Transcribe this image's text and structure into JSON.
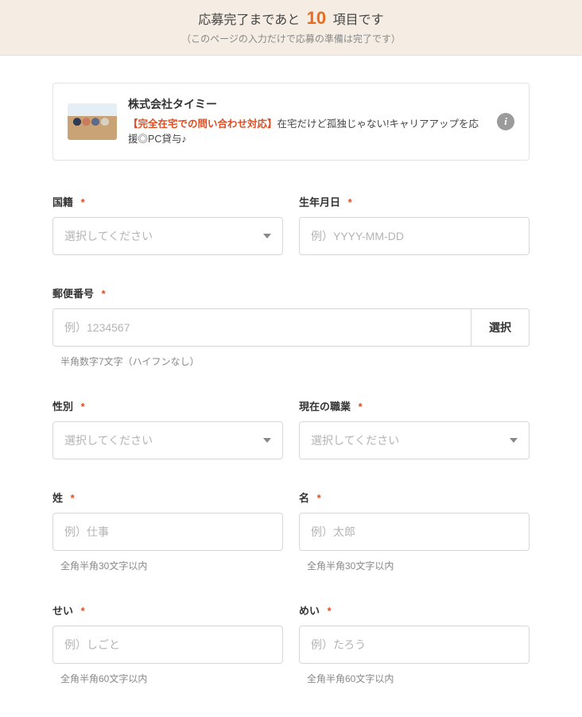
{
  "progress": {
    "prefix": "応募完了まであと",
    "count": "10",
    "suffix": "項目です",
    "sub": "（このページの入力だけで応募の準備は完了です）"
  },
  "job": {
    "company": "株式会社タイミー",
    "title_prefix": "【完全在宅での問い合わせ対応】",
    "title_rest": "在宅だけど孤独じゃない!キャリアアップを応援◎PC貸与♪"
  },
  "info_icon_text": "i",
  "req_mark": "*",
  "fields": {
    "nationality": {
      "label": "国籍",
      "placeholder": "選択してください"
    },
    "dob": {
      "label": "生年月日",
      "placeholder": "例）YYYY-MM-DD"
    },
    "postal": {
      "label": "郵便番号",
      "placeholder": "例）1234567",
      "button": "選択",
      "hint": "半角数字7文字（ハイフンなし）"
    },
    "gender": {
      "label": "性別",
      "placeholder": "選択してください"
    },
    "occupation": {
      "label": "現在の職業",
      "placeholder": "選択してください"
    },
    "lastname": {
      "label": "姓",
      "placeholder": "例）仕事",
      "hint": "全角半角30文字以内"
    },
    "firstname": {
      "label": "名",
      "placeholder": "例）太郎",
      "hint": "全角半角30文字以内"
    },
    "lastname_kana": {
      "label": "せい",
      "placeholder": "例）しごと",
      "hint": "全角半角60文字以内"
    },
    "firstname_kana": {
      "label": "めい",
      "placeholder": "例）たろう",
      "hint": "全角半角60文字以内"
    }
  }
}
